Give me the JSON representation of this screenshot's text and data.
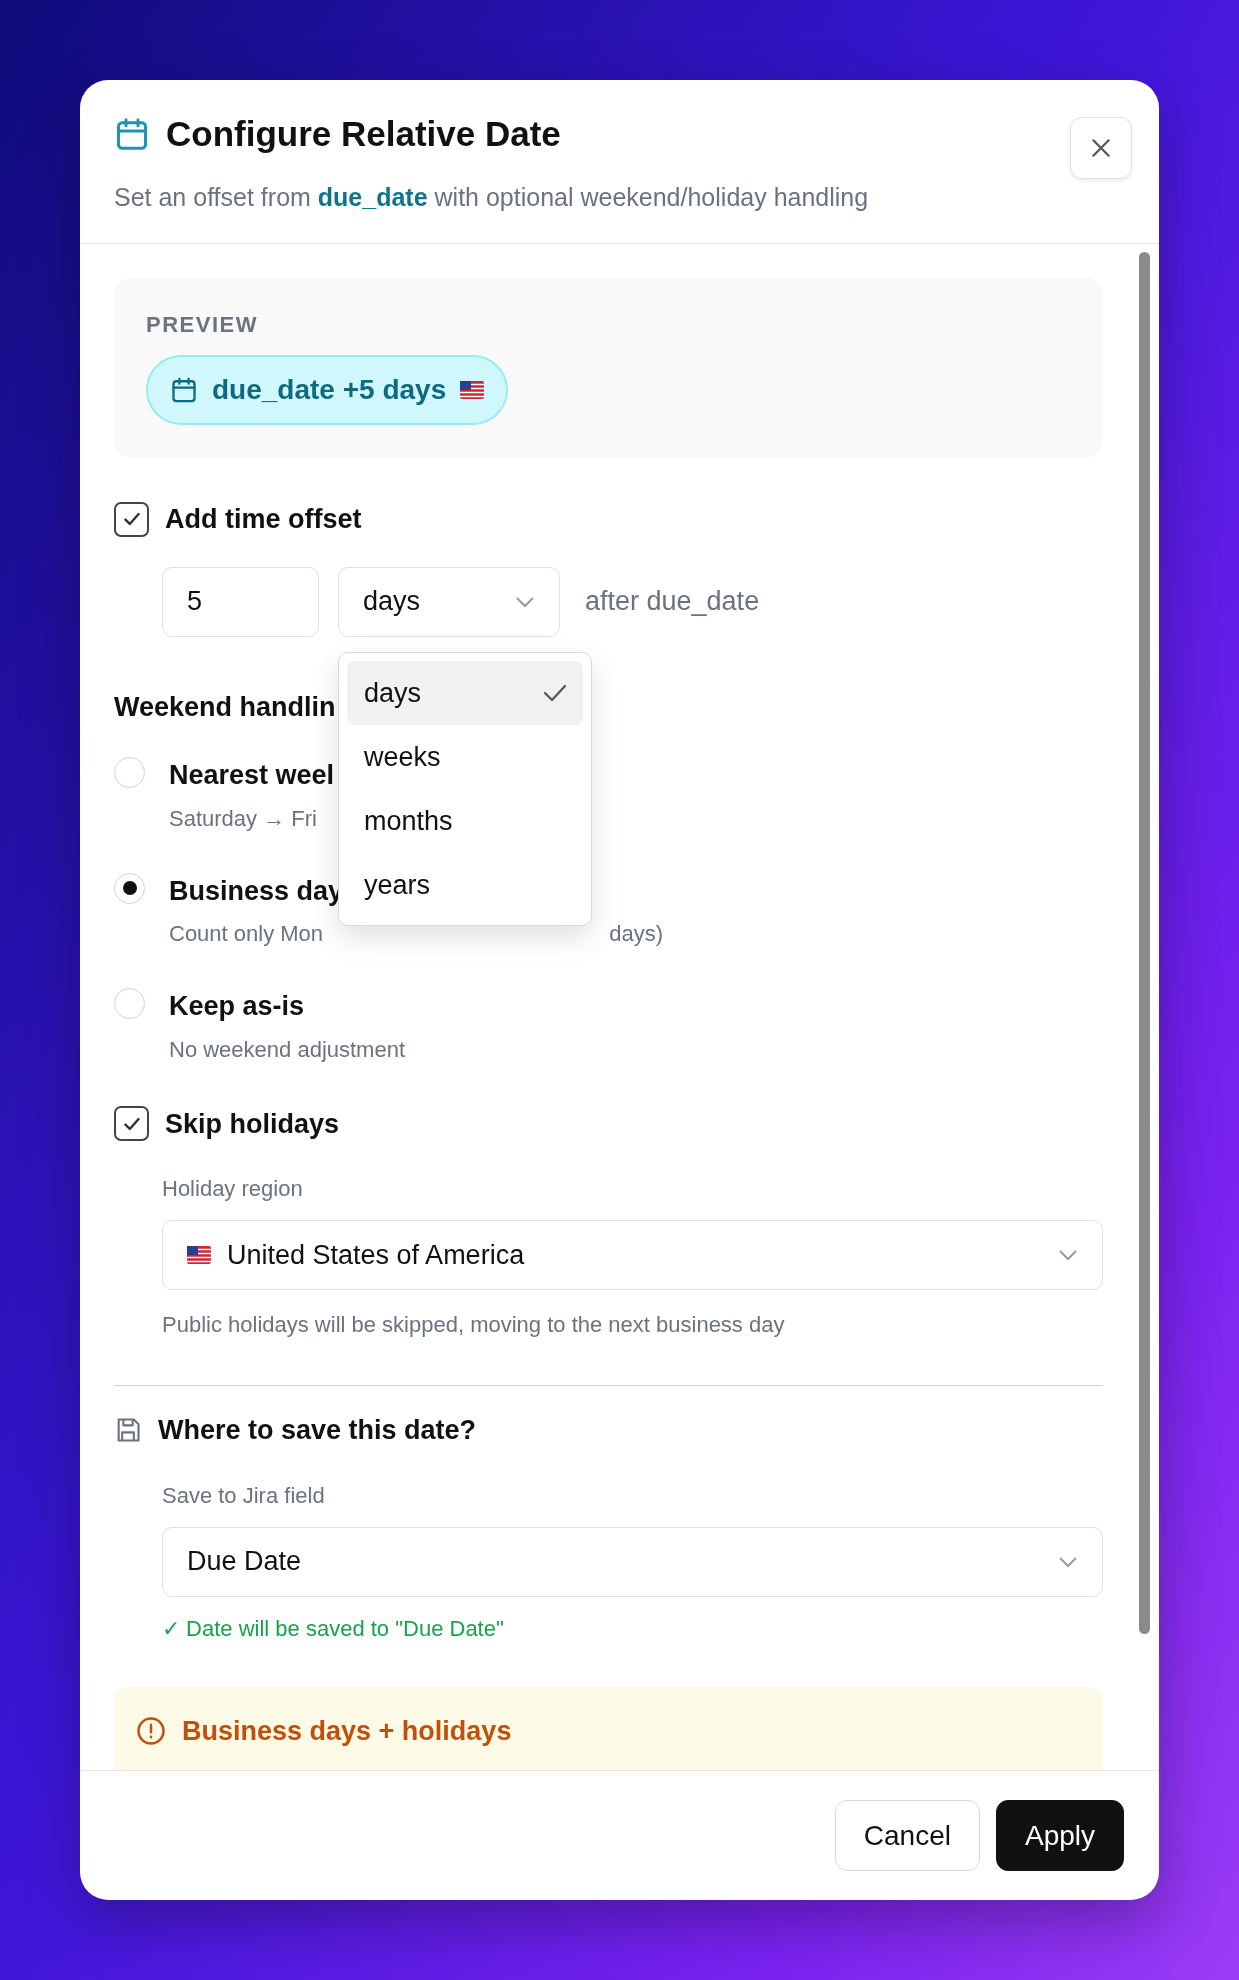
{
  "dialog": {
    "title": "Configure Relative Date",
    "subtitle": "Set an offset from **due_date** with optional weekend/holiday handling"
  },
  "preview": {
    "label": "PREVIEW",
    "chip": "due_date +5 days"
  },
  "time_offset": {
    "label": "Add time offset",
    "checked": true,
    "amount": "5",
    "unit": "days",
    "suffix": "after due_date",
    "menu": [
      {
        "label": "days",
        "selected": true
      },
      {
        "label": "weeks",
        "selected": false
      },
      {
        "label": "months",
        "selected": false
      },
      {
        "label": "years",
        "selected": false
      }
    ]
  },
  "weekend": {
    "heading": "Weekend handlin",
    "options": [
      {
        "label": "Nearest weel",
        "description": [
          "Saturday → Fri"
        ],
        "selected": false
      },
      {
        "label": "Business day",
        "description": [
          "Count only Mon",
          "days)"
        ],
        "selected": true
      },
      {
        "label": "Keep as-is",
        "description": [
          "No weekend adjustment"
        ],
        "selected": false
      }
    ]
  },
  "holidays": {
    "label": "Skip holidays",
    "checked": true,
    "region_label": "Holiday region",
    "region": "United States of America",
    "help": "Public holidays will be skipped, moving to the next business day"
  },
  "save": {
    "heading": "Where to save this date?",
    "field_label": "Save to Jira field",
    "field": "Due Date",
    "confirmation": "✓ Date will be saved to \"Due Date\""
  },
  "warning": {
    "title": "Business days + holidays"
  },
  "buttons": [
    {
      "label": "Cancel",
      "kind": "secondary"
    },
    {
      "label": "Apply",
      "kind": "primary"
    }
  ]
}
